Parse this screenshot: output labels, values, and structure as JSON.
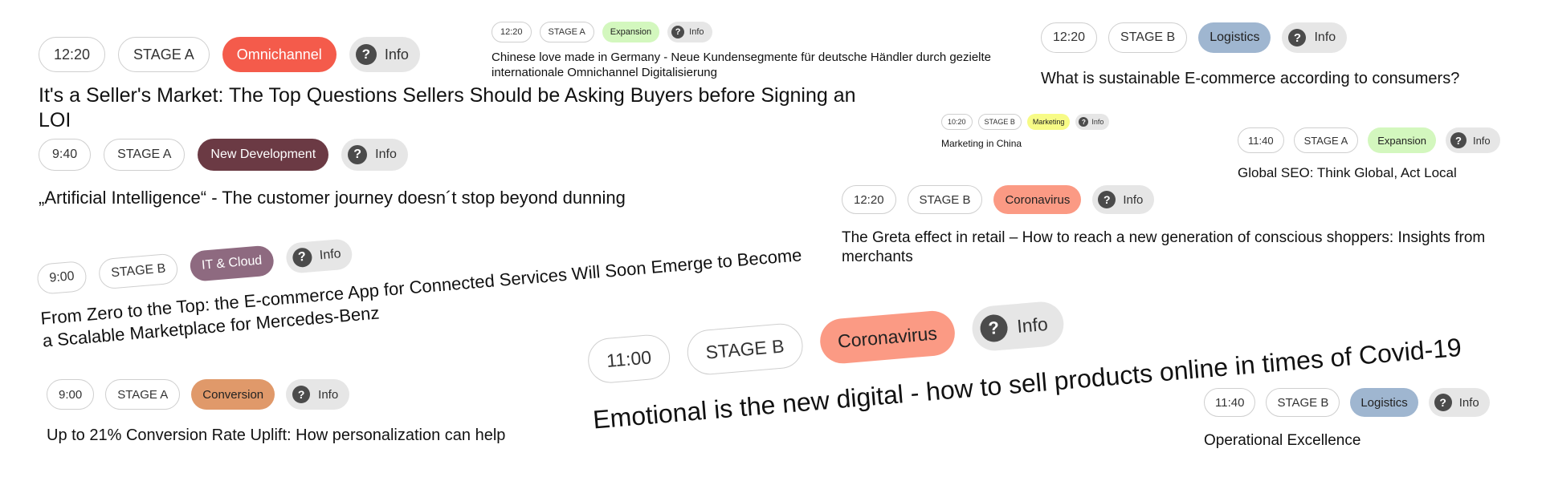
{
  "info_label": "Info",
  "info_icon": "question-circle-icon",
  "sessions": [
    {
      "time": "12:20",
      "stage": "STAGE A",
      "tag": "Omnichannel",
      "tag_color": "#f45b4b",
      "tag_text_color": "#ffffff",
      "title": "It's a Seller's Market: The Top Questions Sellers Should be Asking Buyers before Signing an LOI"
    },
    {
      "time": "9:40",
      "stage": "STAGE A",
      "tag": "New Development",
      "tag_color": "#6b3a44",
      "tag_text_color": "#ffffff",
      "title": "„Artificial Intelligence“ - The customer journey doesn´t stop beyond dunning"
    },
    {
      "time": "9:00",
      "stage": "STAGE B",
      "tag": "IT & Cloud",
      "tag_color": "#8e6a80",
      "tag_text_color": "#ffffff",
      "title": "From Zero to the Top: the E-commerce App for Connected Services Will Soon Emerge to Become a Scalable Marketplace for Mercedes-Benz"
    },
    {
      "time": "9:00",
      "stage": "STAGE A",
      "tag": "Conversion",
      "tag_color": "#e0996a",
      "tag_text_color": "#222222",
      "title": "Up to 21% Conversion Rate Uplift: How personalization can help"
    },
    {
      "time": "12:20",
      "stage": "STAGE A",
      "tag": "Expansion",
      "tag_color": "#d3f7be",
      "tag_text_color": "#222222",
      "title": "Chinese love made in Germany - Neue Kundensegmente für deutsche Händler durch gezielte internationale Omnichannel Digitalisierung"
    },
    {
      "time": "11:00",
      "stage": "STAGE B",
      "tag": "Coronavirus",
      "tag_color": "#fb9a84",
      "tag_text_color": "#222222",
      "title": "Emotional is the new digital - how to sell products online in times of Covid-19"
    },
    {
      "time": "12:20",
      "stage": "STAGE B",
      "tag": "Logistics",
      "tag_color": "#9fb6d0",
      "tag_text_color": "#222222",
      "title": "What is sustainable E-commerce according to consumers?"
    },
    {
      "time": "10:20",
      "stage": "STAGE B",
      "tag": "Marketing",
      "tag_color": "#f7fb86",
      "tag_text_color": "#222222",
      "title": "Marketing in China"
    },
    {
      "time": "11:40",
      "stage": "STAGE A",
      "tag": "Expansion",
      "tag_color": "#d3f7be",
      "tag_text_color": "#222222",
      "title": "Global SEO: Think Global, Act Local"
    },
    {
      "time": "12:20",
      "stage": "STAGE B",
      "tag": "Coronavirus",
      "tag_color": "#fb9a84",
      "tag_text_color": "#222222",
      "title": "The Greta effect in retail – How to reach a new generation of conscious shoppers: Insights from merchants"
    },
    {
      "time": "11:40",
      "stage": "STAGE B",
      "tag": "Logistics",
      "tag_color": "#9fb6d0",
      "tag_text_color": "#222222",
      "title": "Operational Excellence"
    }
  ]
}
